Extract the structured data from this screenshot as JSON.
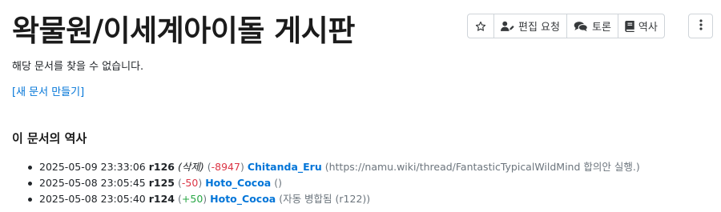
{
  "page": {
    "title": "왁물원/이세계아이돌 게시판",
    "notice": "해당 문서를 찾을 수 없습니다.",
    "create_link": "[새 문서 만들기]"
  },
  "toolbar": {
    "star_icon": "star-icon",
    "edit_request_label": "편집 요청",
    "edit_request_icon": "user-edit-icon",
    "discussion_label": "토론",
    "discussion_icon": "comments-icon",
    "history_label": "역사",
    "history_icon": "book-icon",
    "more_icon": "vertical-ellipsis-icon"
  },
  "history": {
    "heading": "이 문서의 역사",
    "items": [
      {
        "datetime": "2025-05-09 23:33:06",
        "rev": "r126",
        "tag": "(삭제)",
        "change": "-8947",
        "user": "Chitanda_Eru",
        "comment": "(https://namu.wiki/thread/FantasticTypicalWildMind 합의안 실행.)"
      },
      {
        "datetime": "2025-05-08 23:05:45",
        "rev": "r125",
        "tag": "",
        "change": "-50",
        "user": "Hoto_Cocoa",
        "comment": "()"
      },
      {
        "datetime": "2025-05-08 23:05:40",
        "rev": "r124",
        "tag": "",
        "change": "+50",
        "user": "Hoto_Cocoa",
        "comment": "(자동 병합됨 (r122))"
      }
    ]
  },
  "colors": {
    "link": "#0275d8",
    "negative": "#dc3545",
    "positive": "#28a745",
    "muted": "#6c757d"
  }
}
